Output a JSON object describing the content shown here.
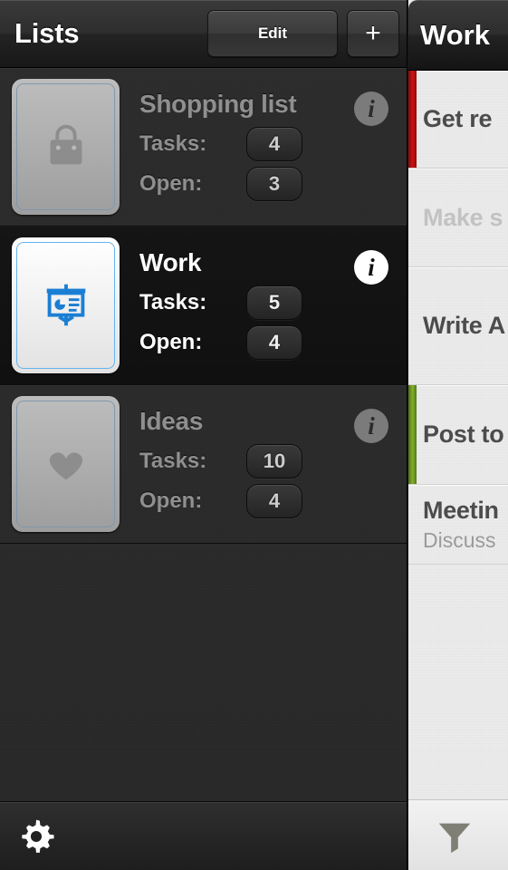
{
  "master": {
    "title": "Lists",
    "edit_label": "Edit",
    "add_label": "+",
    "settings_icon": "gear-icon",
    "stat_labels": {
      "tasks": "Tasks:",
      "open": "Open:"
    },
    "info_glyph": "i",
    "lists": [
      {
        "name": "Shopping list",
        "icon": "shopping-bag-icon",
        "tasks": "4",
        "open": "3",
        "selected": false
      },
      {
        "name": "Work",
        "icon": "presentation-chart-icon",
        "tasks": "5",
        "open": "4",
        "selected": true
      },
      {
        "name": "Ideas",
        "icon": "heart-icon",
        "tasks": "10",
        "open": "4",
        "selected": false
      }
    ]
  },
  "detail": {
    "title": "Work",
    "filter_icon": "funnel-icon",
    "tasks": [
      {
        "title": "Get re",
        "subtitle": "",
        "flag_color": "#b30f0f",
        "done": false
      },
      {
        "title": "Make s",
        "subtitle": "",
        "flag_color": "",
        "done": true
      },
      {
        "title": "Write A",
        "subtitle": "",
        "flag_color": "",
        "done": false
      },
      {
        "title": "Post to",
        "subtitle": "",
        "flag_color": "#6d9b1f",
        "done": false
      },
      {
        "title": "Meetin",
        "subtitle": "Discuss",
        "flag_color": "",
        "done": false
      }
    ]
  },
  "colors": {
    "accent_blue": "#1a7fd4",
    "selected_row_bg": "#131313",
    "panel_bg": "#2b2b2b",
    "detail_bg": "#ebebeb",
    "flag_red": "#b30f0f",
    "flag_green": "#6d9b1f"
  }
}
